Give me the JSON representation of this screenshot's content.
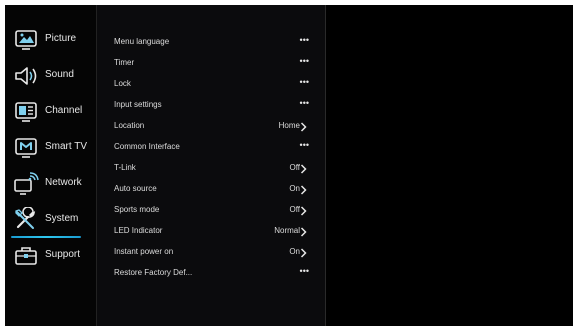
{
  "sidebar": {
    "items": [
      {
        "label": "Picture",
        "icon": "picture-icon"
      },
      {
        "label": "Sound",
        "icon": "sound-icon"
      },
      {
        "label": "Channel",
        "icon": "channel-icon"
      },
      {
        "label": "Smart TV",
        "icon": "smart-tv-icon"
      },
      {
        "label": "Network",
        "icon": "network-icon"
      },
      {
        "label": "System",
        "icon": "system-icon",
        "selected": true
      },
      {
        "label": "Support",
        "icon": "support-icon"
      }
    ]
  },
  "menu": {
    "rows": [
      {
        "label": "Menu language",
        "value": "",
        "control": "dots",
        "dots": "•••"
      },
      {
        "label": "Timer",
        "value": "",
        "control": "dots",
        "dots": "•••"
      },
      {
        "label": "Lock",
        "value": "",
        "control": "dots",
        "dots": "•••"
      },
      {
        "label": "Input settings",
        "value": "",
        "control": "dots",
        "dots": "•••"
      },
      {
        "label": "Location",
        "value": "Home",
        "control": "chevron"
      },
      {
        "label": "Common Interface",
        "value": "",
        "control": "dots",
        "dots": "•••"
      },
      {
        "label": "T-Link",
        "value": "Off",
        "control": "chevron"
      },
      {
        "label": "Auto source",
        "value": "On",
        "control": "chevron"
      },
      {
        "label": "Sports mode",
        "value": "Off",
        "control": "chevron"
      },
      {
        "label": "LED Indicator",
        "value": "Normal",
        "control": "chevron"
      },
      {
        "label": "Instant power on",
        "value": "On",
        "control": "chevron"
      },
      {
        "label": "Restore Factory Def...",
        "value": "",
        "control": "dots",
        "dots": "•••"
      }
    ]
  },
  "colors": {
    "accent": "#2fc8ef",
    "background": "#000000",
    "text": "#dcdcdc"
  }
}
